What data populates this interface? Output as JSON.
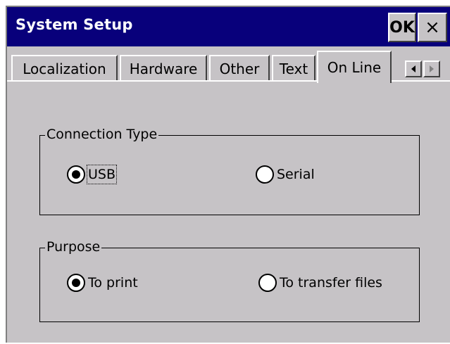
{
  "window": {
    "title": "System Setup",
    "ok_label": "OK",
    "close_label": "×"
  },
  "tabs": [
    {
      "label": "Localization",
      "active": false
    },
    {
      "label": "Hardware",
      "active": false
    },
    {
      "label": "Other",
      "active": false
    },
    {
      "label": "Text",
      "active": false
    },
    {
      "label": "On Line",
      "active": true
    }
  ],
  "tab_scroll": {
    "left_icon": "arrow-left-icon",
    "right_icon": "arrow-right-icon"
  },
  "connection_type": {
    "legend": "Connection Type",
    "options": [
      {
        "label": "USB",
        "selected": true
      },
      {
        "label": "Serial",
        "selected": false
      }
    ]
  },
  "purpose": {
    "legend": "Purpose",
    "options": [
      {
        "label": "To print",
        "selected": true
      },
      {
        "label": "To transfer files",
        "selected": false
      }
    ]
  },
  "colors": {
    "title_bar": "#08007b",
    "face": "#c6c3c6"
  }
}
